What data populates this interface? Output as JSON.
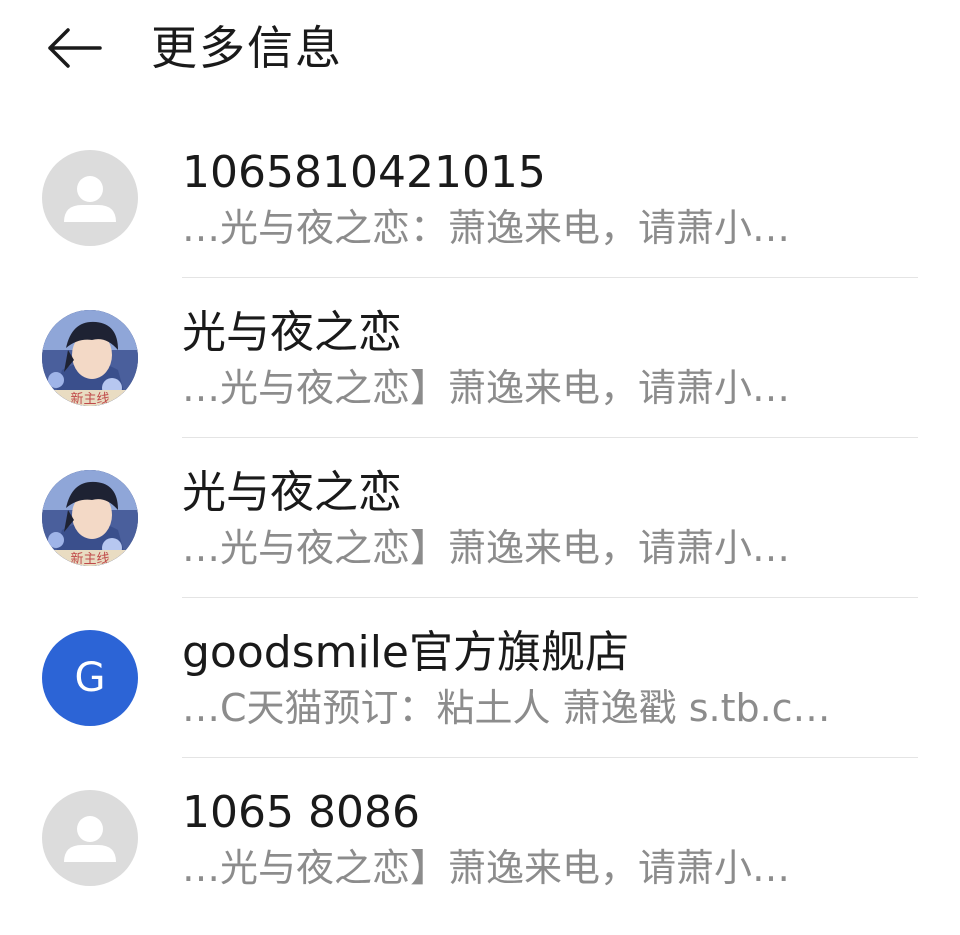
{
  "header": {
    "back_icon": "arrow-left-icon",
    "title": "更多信息"
  },
  "contacts": [
    {
      "name": "1065810421015",
      "preview": "…光与夜之恋：萧逸来电，请萧小…",
      "avatar_type": "default-person-icon"
    },
    {
      "name": "光与夜之恋",
      "preview": "…光与夜之恋】萧逸来电，请萧小…",
      "avatar_type": "game-character-image",
      "avatar_text": "新主线"
    },
    {
      "name": "光与夜之恋",
      "preview": "…光与夜之恋】萧逸来电，请萧小…",
      "avatar_type": "game-character-image",
      "avatar_text": "新主线"
    },
    {
      "name": "goodsmile官方旗舰店",
      "preview": "…C天猫预订：粘土人 萧逸戳 s.tb.c…",
      "avatar_type": "letter",
      "avatar_letter": "G",
      "avatar_color": "#2c64d6"
    },
    {
      "name": "1065 8086",
      "preview": "…光与夜之恋】萧逸来电，请萧小…",
      "avatar_type": "default-person-icon"
    }
  ]
}
